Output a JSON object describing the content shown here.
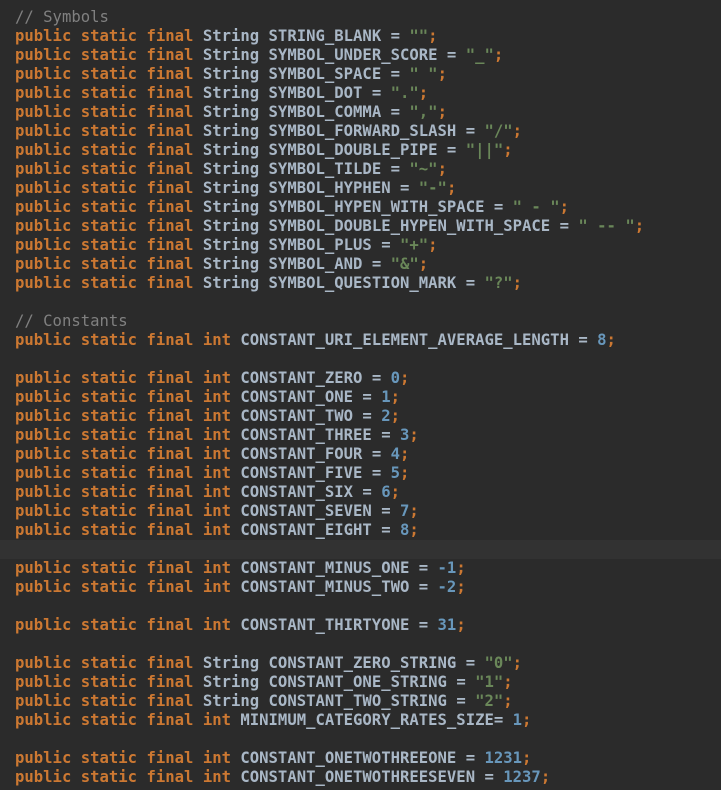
{
  "lines": [
    {
      "kind": "comment",
      "text": "// Symbols"
    },
    {
      "kind": "decl",
      "type": "String",
      "name": "STRING_BLANK",
      "assign": " = ",
      "value": "\"\"",
      "vkind": "str"
    },
    {
      "kind": "decl",
      "type": "String",
      "name": "SYMBOL_UNDER_SCORE",
      "assign": " = ",
      "value": "\"_\"",
      "vkind": "str"
    },
    {
      "kind": "decl",
      "type": "String",
      "name": "SYMBOL_SPACE",
      "assign": " = ",
      "value": "\" \"",
      "vkind": "str"
    },
    {
      "kind": "decl",
      "type": "String",
      "name": "SYMBOL_DOT",
      "assign": " = ",
      "value": "\".\"",
      "vkind": "str"
    },
    {
      "kind": "decl",
      "type": "String",
      "name": "SYMBOL_COMMA",
      "assign": " = ",
      "value": "\",\"",
      "vkind": "str"
    },
    {
      "kind": "decl",
      "type": "String",
      "name": "SYMBOL_FORWARD_SLASH",
      "assign": " = ",
      "value": "\"/\"",
      "vkind": "str"
    },
    {
      "kind": "decl",
      "type": "String",
      "name": "SYMBOL_DOUBLE_PIPE",
      "assign": " = ",
      "value": "\"||\"",
      "vkind": "str"
    },
    {
      "kind": "decl",
      "type": "String",
      "name": "SYMBOL_TILDE",
      "assign": " = ",
      "value": "\"~\"",
      "vkind": "str"
    },
    {
      "kind": "decl",
      "type": "String",
      "name": "SYMBOL_HYPHEN",
      "assign": " = ",
      "value": "\"-\"",
      "vkind": "str"
    },
    {
      "kind": "decl",
      "type": "String",
      "name": "SYMBOL_HYPEN_WITH_SPACE",
      "assign": " = ",
      "value": "\" - \"",
      "vkind": "str"
    },
    {
      "kind": "decl",
      "type": "String",
      "name": "SYMBOL_DOUBLE_HYPEN_WITH_SPACE",
      "assign": " = ",
      "value": "\" -- \"",
      "vkind": "str"
    },
    {
      "kind": "decl",
      "type": "String",
      "name": "SYMBOL_PLUS",
      "assign": " = ",
      "value": "\"+\"",
      "vkind": "str"
    },
    {
      "kind": "decl",
      "type": "String",
      "name": "SYMBOL_AND",
      "assign": " = ",
      "value": "\"&\"",
      "vkind": "str"
    },
    {
      "kind": "decl",
      "type": "String",
      "name": "SYMBOL_QUESTION_MARK",
      "assign": " = ",
      "value": "\"?\"",
      "vkind": "str"
    },
    {
      "kind": "blank"
    },
    {
      "kind": "comment",
      "text": "// Constants"
    },
    {
      "kind": "decl",
      "type": "int",
      "name": "CONSTANT_URI_ELEMENT_AVERAGE_LENGTH",
      "assign": " = ",
      "value": "8",
      "vkind": "num"
    },
    {
      "kind": "blank"
    },
    {
      "kind": "decl",
      "type": "int",
      "name": "CONSTANT_ZERO",
      "assign": " = ",
      "value": "0",
      "vkind": "num"
    },
    {
      "kind": "decl",
      "type": "int",
      "name": "CONSTANT_ONE",
      "assign": " = ",
      "value": "1",
      "vkind": "num"
    },
    {
      "kind": "decl",
      "type": "int",
      "name": "CONSTANT_TWO",
      "assign": " = ",
      "value": "2",
      "vkind": "num"
    },
    {
      "kind": "decl",
      "type": "int",
      "name": "CONSTANT_THREE",
      "assign": " = ",
      "value": "3",
      "vkind": "num"
    },
    {
      "kind": "decl",
      "type": "int",
      "name": "CONSTANT_FOUR",
      "assign": " = ",
      "value": "4",
      "vkind": "num"
    },
    {
      "kind": "decl",
      "type": "int",
      "name": "CONSTANT_FIVE",
      "assign": " = ",
      "value": "5",
      "vkind": "num"
    },
    {
      "kind": "decl",
      "type": "int",
      "name": "CONSTANT_SIX",
      "assign": " = ",
      "value": "6",
      "vkind": "num"
    },
    {
      "kind": "decl",
      "type": "int",
      "name": "CONSTANT_SEVEN",
      "assign": " = ",
      "value": "7",
      "vkind": "num"
    },
    {
      "kind": "decl",
      "type": "int",
      "name": "CONSTANT_EIGHT",
      "assign": " = ",
      "value": "8",
      "vkind": "num"
    },
    {
      "kind": "blank",
      "current": true
    },
    {
      "kind": "decl",
      "type": "int",
      "name": "CONSTANT_MINUS_ONE",
      "assign": " = ",
      "value": "-1",
      "vkind": "num"
    },
    {
      "kind": "decl",
      "type": "int",
      "name": "CONSTANT_MINUS_TWO",
      "assign": " = ",
      "value": "-2",
      "vkind": "num"
    },
    {
      "kind": "blank"
    },
    {
      "kind": "decl",
      "type": "int",
      "name": "CONSTANT_THIRTYONE",
      "assign": " = ",
      "value": "31",
      "vkind": "num"
    },
    {
      "kind": "blank"
    },
    {
      "kind": "decl",
      "type": "String",
      "name": "CONSTANT_ZERO_STRING",
      "assign": " = ",
      "value": "\"0\"",
      "vkind": "str"
    },
    {
      "kind": "decl",
      "type": "String",
      "name": "CONSTANT_ONE_STRING",
      "assign": " = ",
      "value": "\"1\"",
      "vkind": "str"
    },
    {
      "kind": "decl",
      "type": "String",
      "name": "CONSTANT_TWO_STRING",
      "assign": " = ",
      "value": "\"2\"",
      "vkind": "str"
    },
    {
      "kind": "decl",
      "type": "int",
      "name": "MINIMUM_CATEGORY_RATES_SIZE",
      "assign": "= ",
      "value": "1",
      "vkind": "num"
    },
    {
      "kind": "blank"
    },
    {
      "kind": "decl",
      "type": "int",
      "name": "CONSTANT_ONETWOTHREEONE",
      "assign": " = ",
      "value": "1231",
      "vkind": "num"
    },
    {
      "kind": "decl",
      "type": "int",
      "name": "CONSTANT_ONETWOTHREESEVEN",
      "assign": " = ",
      "value": "1237",
      "vkind": "num"
    }
  ],
  "keywords": {
    "mod1": "public",
    "mod2": "static",
    "mod3": "final",
    "term": ";"
  },
  "colors": {
    "background": "#2b2b2b",
    "keyword": "#cc7832",
    "comment": "#808080",
    "identifier": "#a9b7c6",
    "string": "#6a8759",
    "number": "#6897bb",
    "current_line": "#323232"
  }
}
